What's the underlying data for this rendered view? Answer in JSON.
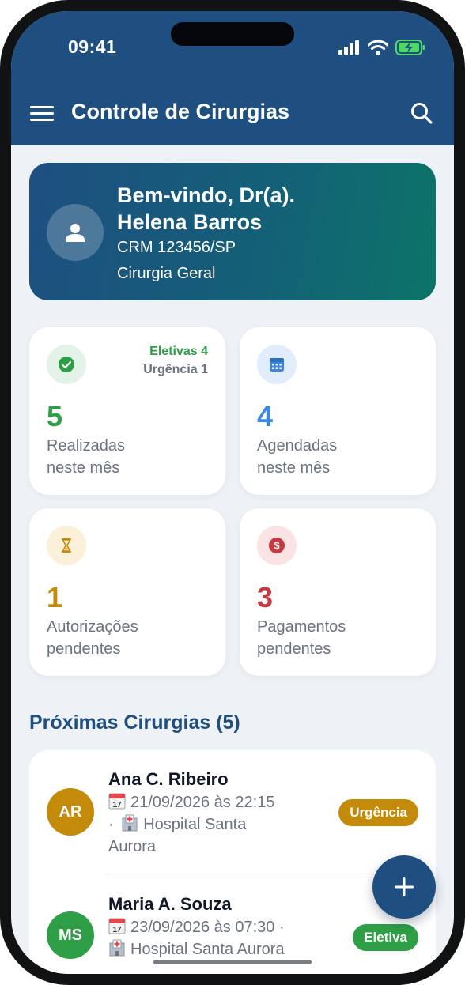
{
  "status_bar": {
    "time": "09:41",
    "icons": [
      "signal-icon",
      "wifi-icon",
      "battery-charging-icon"
    ]
  },
  "app_bar": {
    "title": "Controle de Cirurgias",
    "menu_icon": "menu-icon",
    "search_icon": "search-icon"
  },
  "welcome": {
    "greeting": "Bem-vindo, Dr(a).",
    "name": "Helena Barros",
    "crm": "CRM 123456/SP",
    "specialty": "Cirurgia Geral",
    "avatar_icon": "person-icon"
  },
  "stats": [
    {
      "value": "5",
      "label_1": "Realizadas",
      "label_2": "neste mês",
      "icon": "check-circle-icon",
      "color": "#2e9e47",
      "tag_1": "Eletivas 4",
      "tag_2": "Urgência 1"
    },
    {
      "value": "4",
      "label_1": "Agendadas",
      "label_2": "neste mês",
      "icon": "calendar-icon",
      "color": "#3a86e0"
    },
    {
      "value": "1",
      "label_1": "Autorizações",
      "label_2": "pendentes",
      "icon": "hourglass-icon",
      "color": "#c48a0a"
    },
    {
      "value": "3",
      "label_1": "Pagamentos",
      "label_2": "pendentes",
      "icon": "dollar-icon",
      "color": "#c7383f"
    }
  ],
  "upcoming": {
    "title": "Próximas Cirurgias (5)",
    "items": [
      {
        "initials": "AR",
        "name": "Ana C. Ribeiro",
        "datetime": "21/09/2026 às 22:15",
        "separator": "·",
        "hospital": "Hospital Santa",
        "hospital_cont": "Aurora",
        "badge": "Urgência",
        "avatar_color": "#c48a0a",
        "badge_color": "#c48a0a"
      },
      {
        "initials": "MS",
        "name": "Maria A. Souza",
        "datetime": "23/09/2026 às 07:30 ·",
        "hospital": "Hospital Santa Aurora",
        "badge": "Eletiva",
        "avatar_color": "#2e9e47",
        "badge_color": "#2e9e47"
      }
    ]
  },
  "fab": {
    "icon": "plus-icon",
    "label": "+"
  }
}
